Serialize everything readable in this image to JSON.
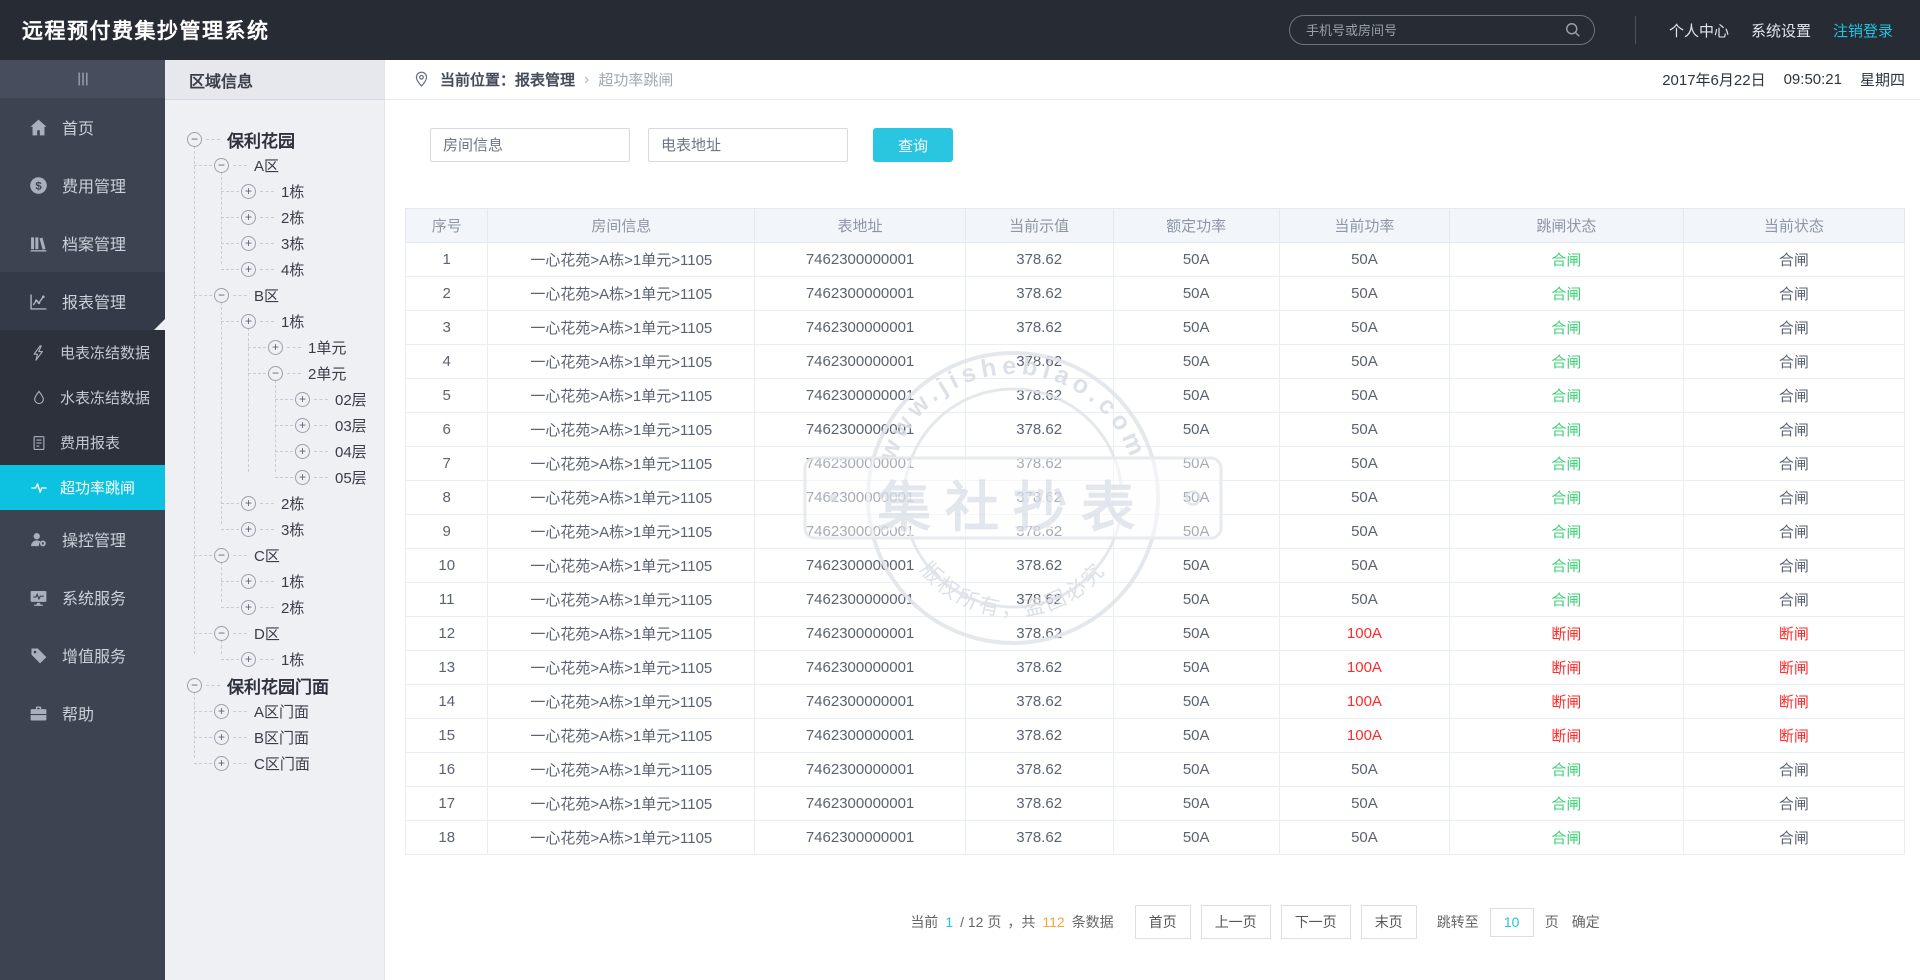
{
  "header": {
    "app_title": "远程预付费集抄管理系统",
    "search_placeholder": "手机号或房间号",
    "search_icon": "search-icon",
    "links": [
      "个人中心",
      "系统设置",
      "注销登录"
    ]
  },
  "sidebar": {
    "collapse_icon": "menu-collapse-icon",
    "items": [
      {
        "label": "首页",
        "icon": "home-icon",
        "level": "top"
      },
      {
        "label": "费用管理",
        "icon": "money-icon",
        "level": "top"
      },
      {
        "label": "档案管理",
        "icon": "archive-icon",
        "level": "top"
      },
      {
        "label": "报表管理",
        "icon": "report-chart-icon",
        "level": "top",
        "expanded": true
      },
      {
        "label": "电表冻结数据",
        "icon": "lightning-icon",
        "level": "sub"
      },
      {
        "label": "水表冻结数据",
        "icon": "water-drop-icon",
        "level": "sub"
      },
      {
        "label": "费用报表",
        "icon": "bill-icon",
        "level": "sub"
      },
      {
        "label": "超功率跳闸",
        "icon": "pulse-icon",
        "level": "sub",
        "active": true
      },
      {
        "label": "操控管理",
        "icon": "user-gear-icon",
        "level": "top"
      },
      {
        "label": "系统服务",
        "icon": "monitor-icon",
        "level": "top"
      },
      {
        "label": "增值服务",
        "icon": "tag-icon",
        "level": "top"
      },
      {
        "label": "帮助",
        "icon": "briefcase-icon",
        "level": "top"
      }
    ]
  },
  "tree_panel": {
    "title": "区域信息",
    "nodes": [
      {
        "label": "保利花园",
        "toggle": "minus",
        "root": true,
        "children": [
          {
            "label": "A区",
            "toggle": "minus",
            "children": [
              {
                "label": "1栋",
                "toggle": "plus"
              },
              {
                "label": "2栋",
                "toggle": "plus"
              },
              {
                "label": "3栋",
                "toggle": "plus"
              },
              {
                "label": "4栋",
                "toggle": "plus"
              }
            ]
          },
          {
            "label": "B区",
            "toggle": "minus",
            "children": [
              {
                "label": "1栋",
                "toggle": "plus",
                "children": [
                  {
                    "label": "1单元",
                    "toggle": "plus"
                  },
                  {
                    "label": "2单元",
                    "toggle": "minus",
                    "children": [
                      {
                        "label": "02层",
                        "toggle": "plus"
                      },
                      {
                        "label": "03层",
                        "toggle": "plus"
                      },
                      {
                        "label": "04层",
                        "toggle": "plus"
                      },
                      {
                        "label": "05层",
                        "toggle": "plus"
                      }
                    ]
                  }
                ]
              },
              {
                "label": "2栋",
                "toggle": "plus"
              },
              {
                "label": "3栋",
                "toggle": "plus"
              }
            ]
          },
          {
            "label": "C区",
            "toggle": "minus",
            "children": [
              {
                "label": "1栋",
                "toggle": "plus"
              },
              {
                "label": "2栋",
                "toggle": "plus"
              }
            ]
          },
          {
            "label": "D区",
            "toggle": "minus",
            "children": [
              {
                "label": "1栋",
                "toggle": "plus"
              }
            ]
          }
        ]
      },
      {
        "label": "保利花园门面",
        "toggle": "minus",
        "root": true,
        "children": [
          {
            "label": "A区门面",
            "toggle": "plus"
          },
          {
            "label": "B区门面",
            "toggle": "plus"
          },
          {
            "label": "C区门面",
            "toggle": "plus"
          }
        ]
      }
    ]
  },
  "breadcrumb": {
    "location_icon": "location-pin-icon",
    "prefix": "当前位置：报表管理",
    "separator": "›",
    "current": "超功率跳闸"
  },
  "datetime": {
    "date": "2017年6月22日",
    "time": "09:50:21",
    "weekday": "星期四"
  },
  "filters": {
    "room_placeholder": "房间信息",
    "meter_placeholder": "电表地址",
    "search_button": "查询"
  },
  "table": {
    "columns": [
      "序号",
      "房间信息",
      "表地址",
      "当前示值",
      "额定功率",
      "当前功率",
      "跳闸状态",
      "当前状态"
    ],
    "rows": [
      {
        "seq": 1,
        "room": "一心花苑>A栋>1单元>1105",
        "addr": "7462300000001",
        "value": "378.62",
        "rated": "50A",
        "power": "50A",
        "trip": "合闸",
        "status": "合闸",
        "alarm": false
      },
      {
        "seq": 2,
        "room": "一心花苑>A栋>1单元>1105",
        "addr": "7462300000001",
        "value": "378.62",
        "rated": "50A",
        "power": "50A",
        "trip": "合闸",
        "status": "合闸",
        "alarm": false
      },
      {
        "seq": 3,
        "room": "一心花苑>A栋>1单元>1105",
        "addr": "7462300000001",
        "value": "378.62",
        "rated": "50A",
        "power": "50A",
        "trip": "合闸",
        "status": "合闸",
        "alarm": false
      },
      {
        "seq": 4,
        "room": "一心花苑>A栋>1单元>1105",
        "addr": "7462300000001",
        "value": "378.62",
        "rated": "50A",
        "power": "50A",
        "trip": "合闸",
        "status": "合闸",
        "alarm": false
      },
      {
        "seq": 5,
        "room": "一心花苑>A栋>1单元>1105",
        "addr": "7462300000001",
        "value": "378.62",
        "rated": "50A",
        "power": "50A",
        "trip": "合闸",
        "status": "合闸",
        "alarm": false
      },
      {
        "seq": 6,
        "room": "一心花苑>A栋>1单元>1105",
        "addr": "7462300000001",
        "value": "378.62",
        "rated": "50A",
        "power": "50A",
        "trip": "合闸",
        "status": "合闸",
        "alarm": false
      },
      {
        "seq": 7,
        "room": "一心花苑>A栋>1单元>1105",
        "addr": "7462300000001",
        "value": "378.62",
        "rated": "50A",
        "power": "50A",
        "trip": "合闸",
        "status": "合闸",
        "alarm": false
      },
      {
        "seq": 8,
        "room": "一心花苑>A栋>1单元>1105",
        "addr": "7462300000001",
        "value": "378.62",
        "rated": "50A",
        "power": "50A",
        "trip": "合闸",
        "status": "合闸",
        "alarm": false
      },
      {
        "seq": 9,
        "room": "一心花苑>A栋>1单元>1105",
        "addr": "7462300000001",
        "value": "378.62",
        "rated": "50A",
        "power": "50A",
        "trip": "合闸",
        "status": "合闸",
        "alarm": false
      },
      {
        "seq": 10,
        "room": "一心花苑>A栋>1单元>1105",
        "addr": "7462300000001",
        "value": "378.62",
        "rated": "50A",
        "power": "50A",
        "trip": "合闸",
        "status": "合闸",
        "alarm": false
      },
      {
        "seq": 11,
        "room": "一心花苑>A栋>1单元>1105",
        "addr": "7462300000001",
        "value": "378.62",
        "rated": "50A",
        "power": "50A",
        "trip": "合闸",
        "status": "合闸",
        "alarm": false
      },
      {
        "seq": 12,
        "room": "一心花苑>A栋>1单元>1105",
        "addr": "7462300000001",
        "value": "378.62",
        "rated": "50A",
        "power": "100A",
        "trip": "断闸",
        "status": "断闸",
        "alarm": true
      },
      {
        "seq": 13,
        "room": "一心花苑>A栋>1单元>1105",
        "addr": "7462300000001",
        "value": "378.62",
        "rated": "50A",
        "power": "100A",
        "trip": "断闸",
        "status": "断闸",
        "alarm": true
      },
      {
        "seq": 14,
        "room": "一心花苑>A栋>1单元>1105",
        "addr": "7462300000001",
        "value": "378.62",
        "rated": "50A",
        "power": "100A",
        "trip": "断闸",
        "status": "断闸",
        "alarm": true
      },
      {
        "seq": 15,
        "room": "一心花苑>A栋>1单元>1105",
        "addr": "7462300000001",
        "value": "378.62",
        "rated": "50A",
        "power": "100A",
        "trip": "断闸",
        "status": "断闸",
        "alarm": true
      },
      {
        "seq": 16,
        "room": "一心花苑>A栋>1单元>1105",
        "addr": "7462300000001",
        "value": "378.62",
        "rated": "50A",
        "power": "50A",
        "trip": "合闸",
        "status": "合闸",
        "alarm": false
      },
      {
        "seq": 17,
        "room": "一心花苑>A栋>1单元>1105",
        "addr": "7462300000001",
        "value": "378.62",
        "rated": "50A",
        "power": "50A",
        "trip": "合闸",
        "status": "合闸",
        "alarm": false
      },
      {
        "seq": 18,
        "room": "一心花苑>A栋>1单元>1105",
        "addr": "7462300000001",
        "value": "378.62",
        "rated": "50A",
        "power": "50A",
        "trip": "合闸",
        "status": "合闸",
        "alarm": false
      }
    ]
  },
  "pagination": {
    "label_current": "当前",
    "current_page": "1",
    "label_pages": "/ 12 页",
    "label_total": "，共",
    "total_count": "112",
    "label_records": "条数据",
    "buttons": [
      "首页",
      "上一页",
      "下一页",
      "末页"
    ],
    "jump": {
      "label": "跳转至",
      "value": "10",
      "unit": "页",
      "confirm": "确定"
    }
  },
  "watermark": {
    "top_text": "www.jishebiao.com",
    "center_text": "集社抄表",
    "bottom_text": "版权所有，盗图必究"
  },
  "colors": {
    "accent": "#1fc4e0",
    "active_menu": "#0cc2e0",
    "status_green": "#3ed078",
    "status_red": "#fb2b2b",
    "count_orange": "#f5a63c"
  }
}
